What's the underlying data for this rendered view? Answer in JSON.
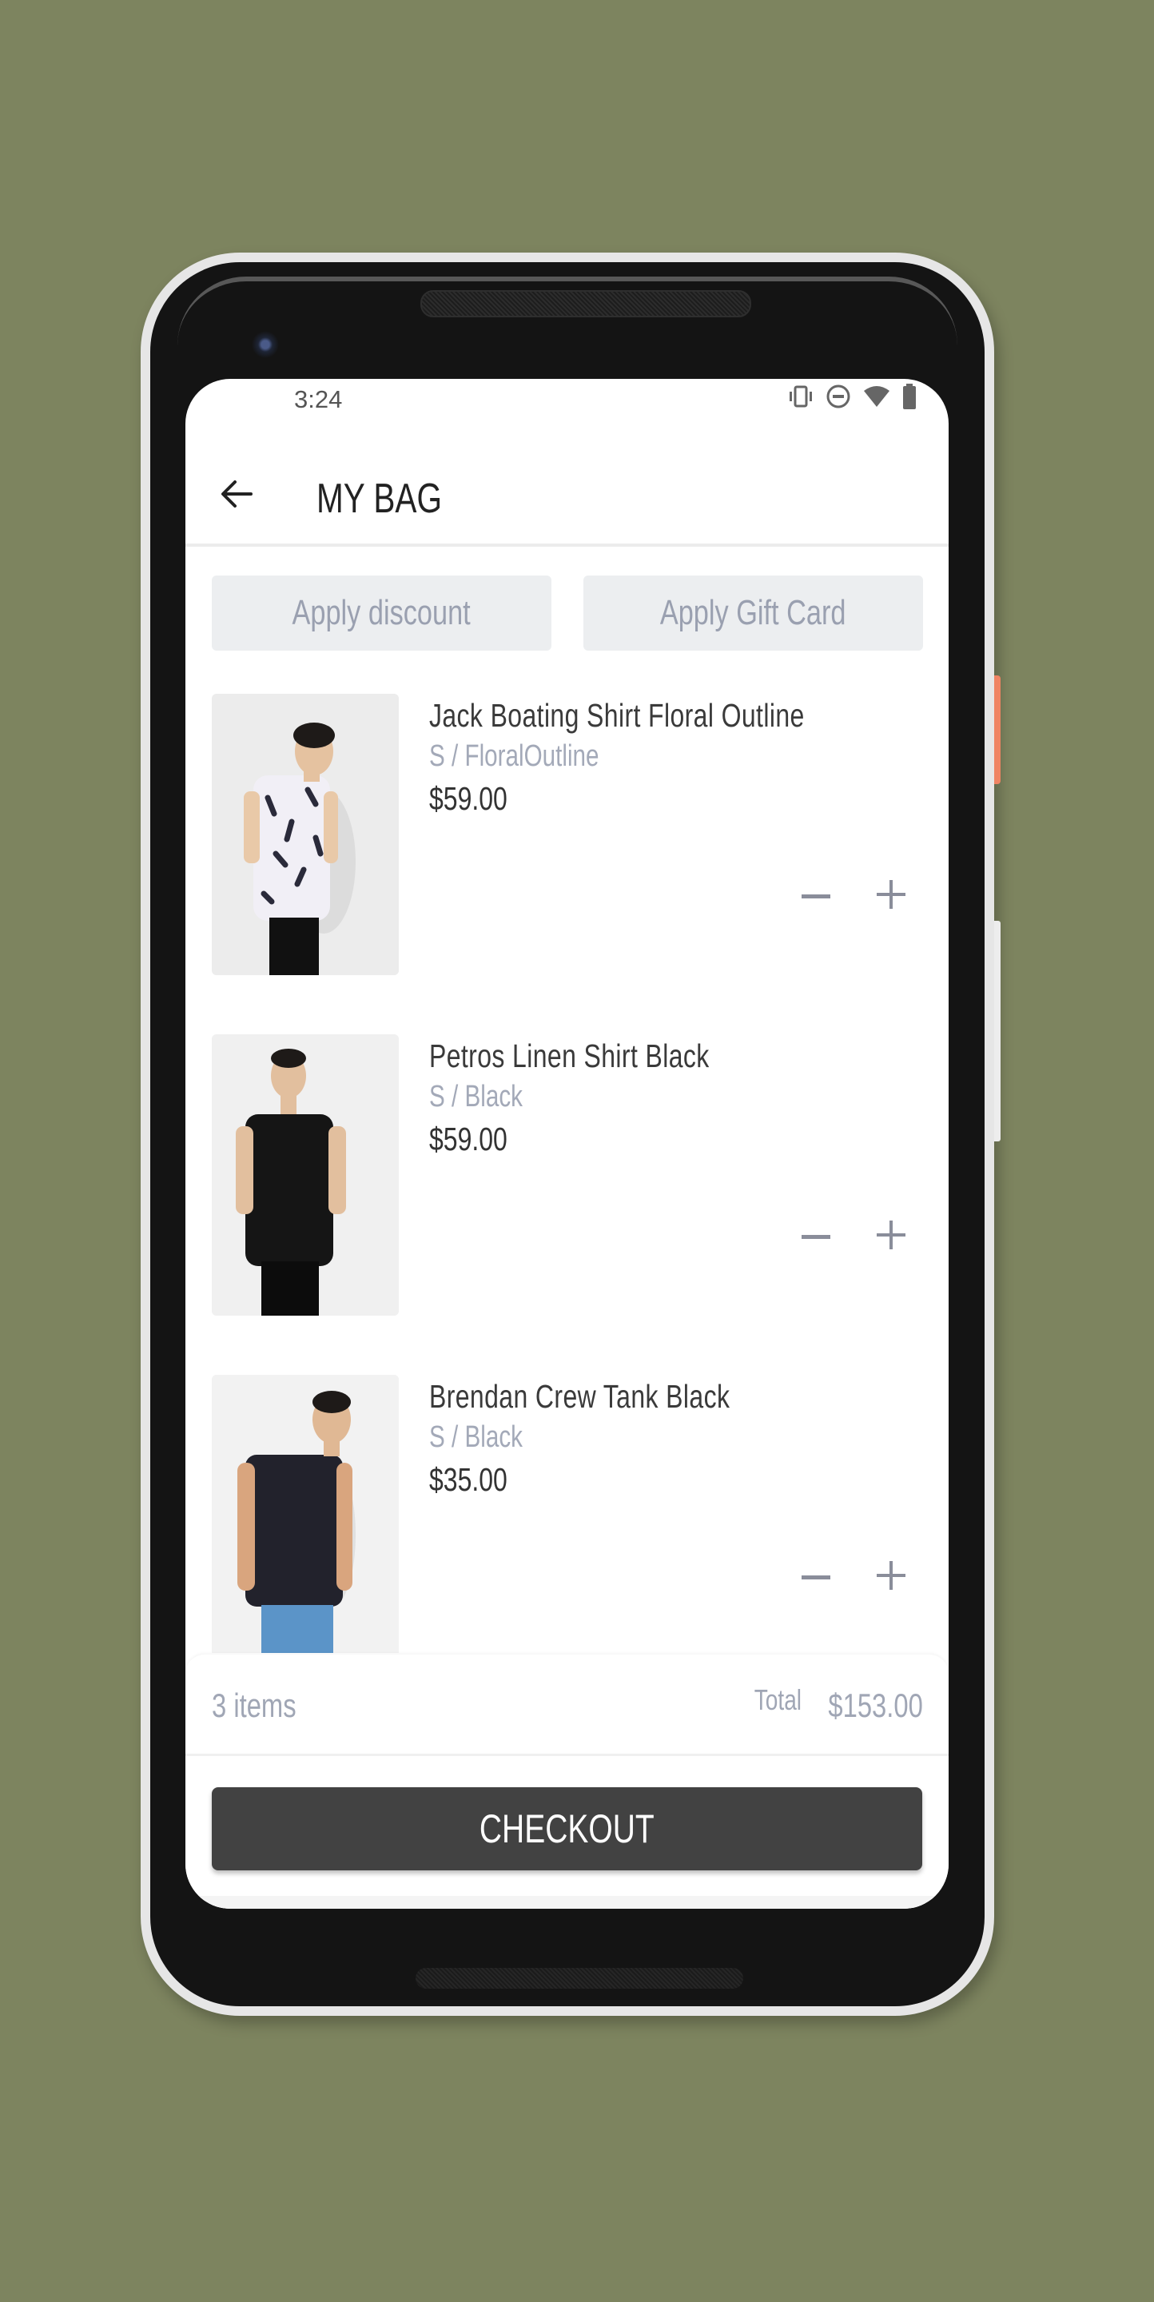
{
  "status_bar": {
    "time": "3:24",
    "icons": [
      "vibrate-icon",
      "do-not-disturb-icon",
      "wifi-icon",
      "battery-icon"
    ]
  },
  "app_bar": {
    "back_icon": "arrow-left-icon",
    "title": "MY BAG"
  },
  "actions": {
    "apply_discount_label": "Apply discount",
    "apply_gift_card_label": "Apply Gift Card"
  },
  "cart": {
    "items": [
      {
        "name": "Jack Boating Shirt Floral Outline",
        "variant": "S / FloralOutline",
        "price": "$59.00",
        "image": "white floral short-sleeve shirt on model"
      },
      {
        "name": "Petros Linen Shirt Black",
        "variant": "S / Black",
        "price": "$59.00",
        "image": "black linen short-sleeve shirt on model"
      },
      {
        "name": "Brendan Crew Tank Black",
        "variant": "S / Black",
        "price": "$35.00",
        "image": "black crew tank on model with blue jeans"
      }
    ],
    "decrease_icon": "minus-icon",
    "increase_icon": "plus-icon"
  },
  "summary": {
    "item_count": "3 items",
    "total_label": "Total",
    "total_value": "$153.00"
  },
  "checkout": {
    "label": "CHECKOUT"
  },
  "colors": {
    "background": "#7d845f",
    "checkout_button": "#424242",
    "muted_text": "#a0a6b5",
    "secondary_button_bg": "#eceef0",
    "power_button": "#f08463"
  }
}
